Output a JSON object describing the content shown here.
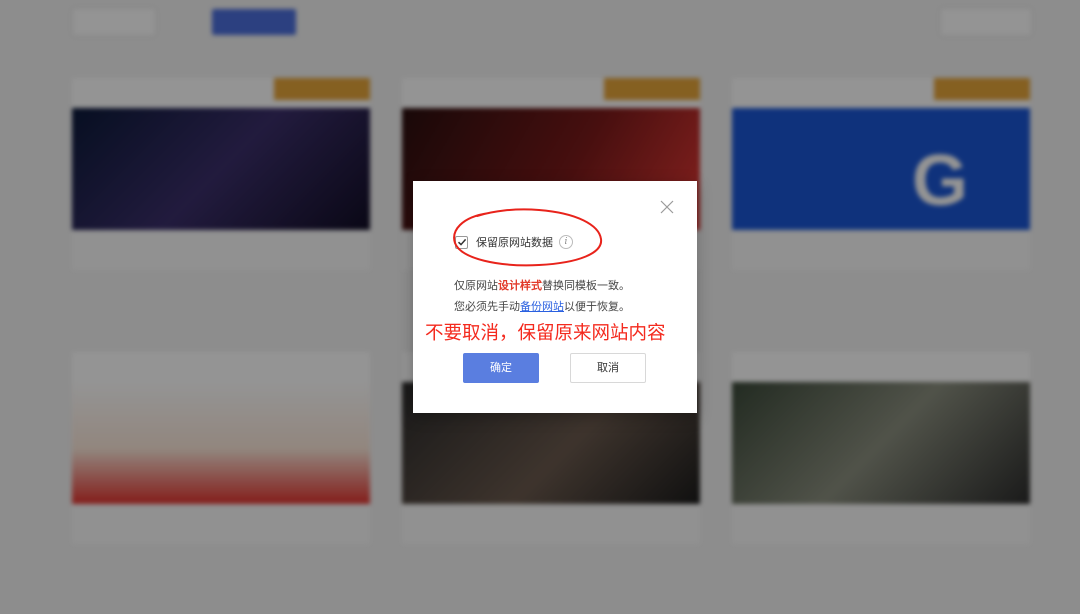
{
  "background": {
    "industry_select": "",
    "tabs": [
      "",
      "",
      "",
      ""
    ],
    "filter_button": "",
    "cards": [
      {
        "badge": "",
        "title": ""
      },
      {
        "badge": "",
        "title": ""
      },
      {
        "badge": "",
        "title": ""
      },
      {
        "title": ""
      },
      {
        "title": ""
      },
      {
        "title": ""
      }
    ]
  },
  "dialog": {
    "checkbox_label": "保留原网站数据",
    "checkbox_checked": true,
    "info_glyph": "i",
    "desc1_prefix": "仅原网站",
    "desc1_emphasis": "设计样式",
    "desc1_suffix": "替换同模板一致。",
    "desc2_prefix": "您必须先手动",
    "desc2_link": "备份网站",
    "desc2_suffix": "以便于恢复。",
    "confirm_label": "确定",
    "cancel_label": "取消"
  },
  "annotation": {
    "text": "不要取消，保留原来网站内容",
    "color": "#f42a1e"
  },
  "colors": {
    "primary": "#5a7ee0",
    "emphasis": "#e23a2a",
    "link": "#2a60e0"
  }
}
